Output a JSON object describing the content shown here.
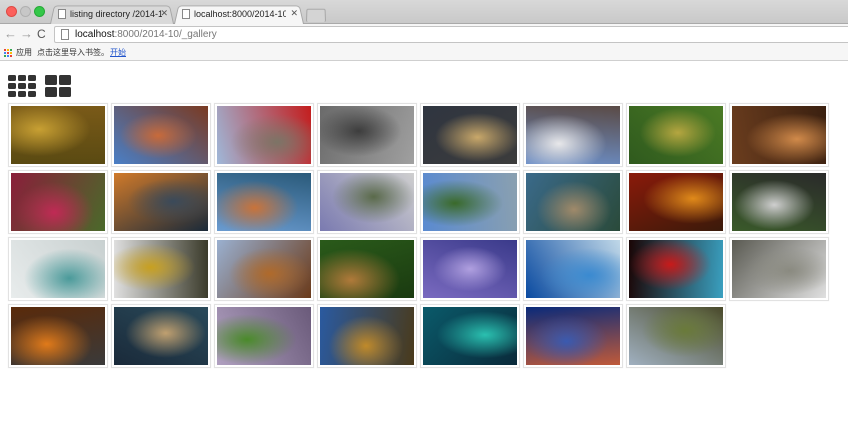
{
  "browser": {
    "tabs": [
      {
        "title": "listing directory /2014-10",
        "active": false
      },
      {
        "title": "localhost:8000/2014-10/_g",
        "active": true
      }
    ],
    "url_host": "localhost",
    "url_rest": ":8000/2014-10/_gallery",
    "bookmarks": {
      "apps_label": "应用",
      "import_label": "点击这里导入书签。",
      "start_label": "开始"
    }
  },
  "view_toggle": {
    "small_grid_icon": "grid-3x3-icon",
    "large_grid_icon": "grid-2x2-icon"
  },
  "gallery": {
    "thumbnails": [
      {
        "subject": "pears",
        "colors": [
          "#5a4a12",
          "#c8a033",
          "#7a5a18"
        ]
      },
      {
        "subject": "hilltop fortress",
        "colors": [
          "#4a7fc6",
          "#c86a3a",
          "#7a3a22"
        ]
      },
      {
        "subject": "castle with poppies",
        "colors": [
          "#9fb8d9",
          "#7c7466",
          "#c31d1d"
        ]
      },
      {
        "subject": "quail",
        "colors": [
          "#6a6a6a",
          "#3d3d3d",
          "#a0a0a0"
        ]
      },
      {
        "subject": "ornate gate",
        "colors": [
          "#2f3540",
          "#c9a86a",
          "#3c3c3c"
        ]
      },
      {
        "subject": "snowy mountains",
        "colors": [
          "#6c8fc8",
          "#e8e8ea",
          "#5a4a45"
        ]
      },
      {
        "subject": "green crater",
        "colors": [
          "#2f5a1e",
          "#b5a640",
          "#4b7a24"
        ]
      },
      {
        "subject": "sandstone canyon",
        "colors": [
          "#6b3d1e",
          "#d18a4a",
          "#3a2010"
        ]
      },
      {
        "subject": "red wetland",
        "colors": [
          "#8a1e3a",
          "#c02a55",
          "#4a6a2a"
        ]
      },
      {
        "subject": "sunset lake",
        "colors": [
          "#d07a2a",
          "#3a4a5a",
          "#1a2a3a"
        ]
      },
      {
        "subject": "sea stacks",
        "colors": [
          "#6a9bd0",
          "#c9733a",
          "#2a5a7a"
        ]
      },
      {
        "subject": "dam aqueduct",
        "colors": [
          "#7a7ab0",
          "#5a6a4a",
          "#cfcfcf"
        ]
      },
      {
        "subject": "coastal ruins",
        "colors": [
          "#5a8ad0",
          "#3a6a2a",
          "#8aa0b0"
        ]
      },
      {
        "subject": "venetian facade",
        "colors": [
          "#3a6a8a",
          "#a08a6a",
          "#2a4a3a"
        ]
      },
      {
        "subject": "red shell",
        "colors": [
          "#8a1a0a",
          "#e08a1a",
          "#3a1a0a"
        ]
      },
      {
        "subject": "lemurs",
        "colors": [
          "#3a5a2a",
          "#cfcfcf",
          "#2a2a2a"
        ]
      },
      {
        "subject": "white dunes",
        "colors": [
          "#e8ecec",
          "#4a9a9a",
          "#c8d0d0"
        ]
      },
      {
        "subject": "snowy forest",
        "colors": [
          "#e0e0e0",
          "#c8a020",
          "#3a3a2a"
        ]
      },
      {
        "subject": "desert canyon",
        "colors": [
          "#9ab0d0",
          "#b06a2a",
          "#6a3a1a"
        ]
      },
      {
        "subject": "chipmunk",
        "colors": [
          "#2a5a1a",
          "#b07a3a",
          "#1a3a10"
        ]
      },
      {
        "subject": "purple mountain lake",
        "colors": [
          "#7a6ac0",
          "#b0a0e0",
          "#3a3a8a"
        ]
      },
      {
        "subject": "whale shark",
        "colors": [
          "#0a4aa0",
          "#3a8ad0",
          "#c0d8e8"
        ]
      },
      {
        "subject": "nebula eye",
        "colors": [
          "#1a0505",
          "#c81a1a",
          "#3aa0c0"
        ]
      },
      {
        "subject": "wildcat",
        "colors": [
          "#5a5a52",
          "#8a8a80",
          "#e0e0e0"
        ]
      },
      {
        "subject": "pumpkins",
        "colors": [
          "#5a2a0a",
          "#e07a1a",
          "#3a3a3a"
        ]
      },
      {
        "subject": "misty river",
        "colors": [
          "#1a2a3a",
          "#c0a070",
          "#2a4a5a"
        ]
      },
      {
        "subject": "plant sprouts",
        "colors": [
          "#b0a0c0",
          "#4a8a2a",
          "#6a5a7a"
        ]
      },
      {
        "subject": "cliff monastery",
        "colors": [
          "#2a5aa0",
          "#c08a2a",
          "#4a3a1a"
        ]
      },
      {
        "subject": "turquoise cave",
        "colors": [
          "#0a5a6a",
          "#2ac0b0",
          "#0a2a3a"
        ]
      },
      {
        "subject": "night city coast",
        "colors": [
          "#0a2a7a",
          "#3a5ab0",
          "#c05a3a"
        ]
      },
      {
        "subject": "mossy field",
        "colors": [
          "#a0b0c0",
          "#6a7a3a",
          "#4a4a2a"
        ]
      }
    ]
  }
}
